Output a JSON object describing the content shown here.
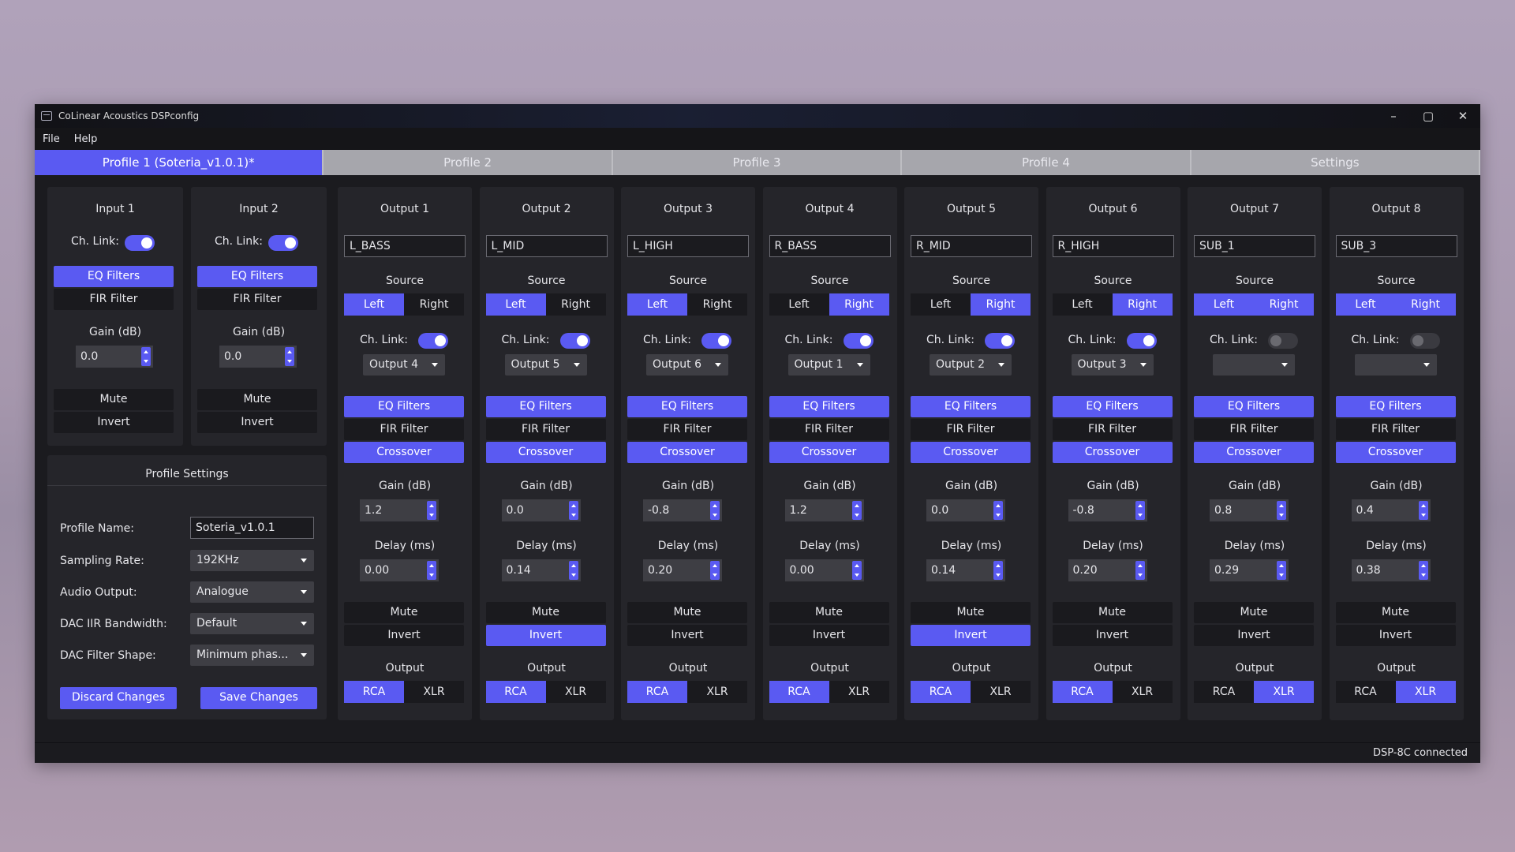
{
  "window": {
    "title": "CoLinear Acoustics DSPconfig",
    "minimize": "–",
    "maximize": "▢",
    "close": "✕"
  },
  "menu": [
    "File",
    "Help"
  ],
  "tabs": [
    "Profile 1 (Soteria_v1.0.1)*",
    "Profile 2",
    "Profile 3",
    "Profile 4",
    "Settings"
  ],
  "active_tab": 0,
  "labels": {
    "ch_link": "Ch. Link:",
    "eq": "EQ Filters",
    "fir": "FIR Filter",
    "crossover": "Crossover",
    "gain": "Gain (dB)",
    "delay": "Delay (ms)",
    "mute": "Mute",
    "invert": "Invert",
    "source": "Source",
    "left": "Left",
    "right": "Right",
    "output": "Output",
    "rca": "RCA",
    "xlr": "XLR"
  },
  "inputs": [
    {
      "title": "Input 1",
      "ch_link": true,
      "gain": "0.0"
    },
    {
      "title": "Input 2",
      "ch_link": true,
      "gain": "0.0"
    }
  ],
  "profile_settings": {
    "title": "Profile Settings",
    "profile_name_label": "Profile Name:",
    "profile_name": "Soteria_v1.0.1",
    "sampling_rate_label": "Sampling Rate:",
    "sampling_rate": "192KHz",
    "audio_output_label": "Audio Output:",
    "audio_output": "Analogue",
    "dac_iir_label": "DAC IIR Bandwidth:",
    "dac_iir": "Default",
    "dac_filter_label": "DAC Filter Shape:",
    "dac_filter": "Minimum phas...",
    "discard": "Discard Changes",
    "save": "Save Changes"
  },
  "outputs": [
    {
      "title": "Output 1",
      "name": "L_BASS",
      "source": "Left",
      "ch_link": true,
      "link_to": "Output 4",
      "gain": "1.2",
      "delay": "0.00",
      "invert": false,
      "conn": "RCA"
    },
    {
      "title": "Output 2",
      "name": "L_MID",
      "source": "Left",
      "ch_link": true,
      "link_to": "Output 5",
      "gain": "0.0",
      "delay": "0.14",
      "invert": true,
      "conn": "RCA"
    },
    {
      "title": "Output 3",
      "name": "L_HIGH",
      "source": "Left",
      "ch_link": true,
      "link_to": "Output 6",
      "gain": "-0.8",
      "delay": "0.20",
      "invert": false,
      "conn": "RCA"
    },
    {
      "title": "Output 4",
      "name": "R_BASS",
      "source": "Right",
      "ch_link": true,
      "link_to": "Output 1",
      "gain": "1.2",
      "delay": "0.00",
      "invert": false,
      "conn": "RCA"
    },
    {
      "title": "Output 5",
      "name": "R_MID",
      "source": "Right",
      "ch_link": true,
      "link_to": "Output 2",
      "gain": "0.0",
      "delay": "0.14",
      "invert": true,
      "conn": "RCA"
    },
    {
      "title": "Output 6",
      "name": "R_HIGH",
      "source": "Right",
      "ch_link": true,
      "link_to": "Output 3",
      "gain": "-0.8",
      "delay": "0.20",
      "invert": false,
      "conn": "RCA"
    },
    {
      "title": "Output 7",
      "name": "SUB_1",
      "source": "Both",
      "ch_link": false,
      "link_to": "",
      "gain": "0.8",
      "delay": "0.29",
      "invert": false,
      "conn": "XLR"
    },
    {
      "title": "Output 8",
      "name": "SUB_3",
      "source": "Both",
      "ch_link": false,
      "link_to": "",
      "gain": "0.4",
      "delay": "0.38",
      "invert": false,
      "conn": "XLR"
    }
  ],
  "status": "DSP-8C connected",
  "colors": {
    "accent": "#5a5af2",
    "panel": "#25252a",
    "window": "#1b1b1f"
  }
}
